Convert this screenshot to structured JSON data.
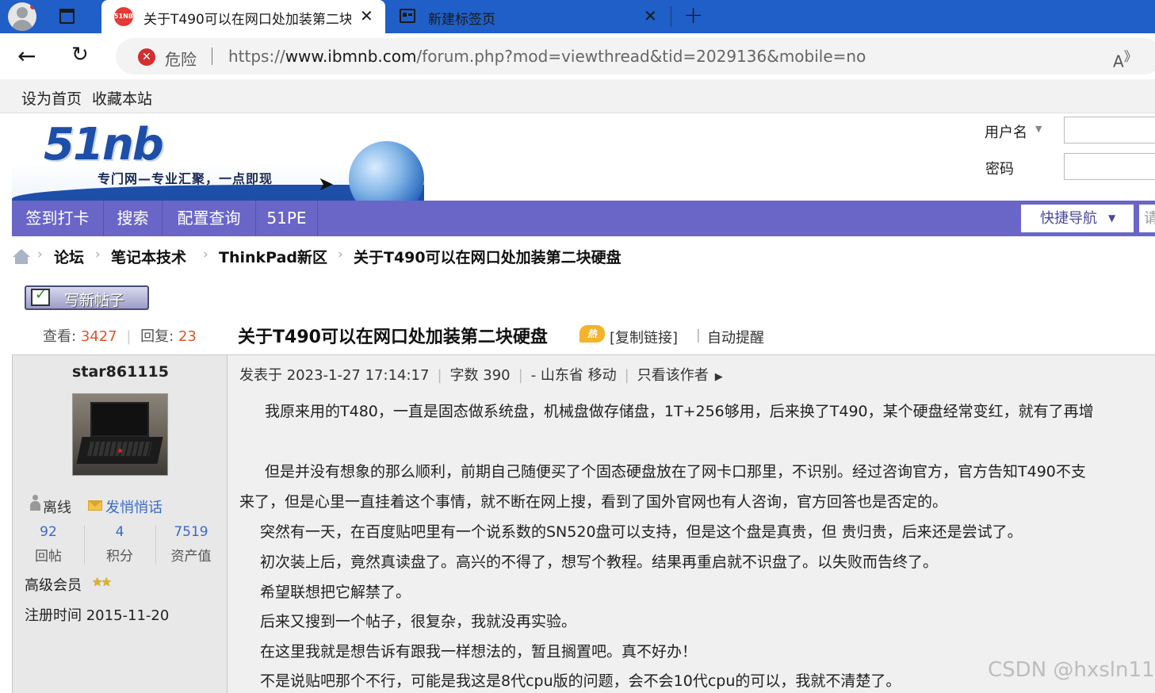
{
  "browser": {
    "tabs": [
      {
        "favicon": "51nb-logo",
        "title": "关于T490可以在网口处加装第二块硬盘",
        "active": true
      },
      {
        "favicon": "new-tab-icon",
        "title": "新建标签页",
        "active": false
      }
    ],
    "security_label": "危险",
    "url_prefix": "https://",
    "url_host": "www.ibmnb.com",
    "url_path": "/forum.php?mod=viewthread&tid=2029136&mobile=no"
  },
  "topbar": {
    "set_home": "设为首页",
    "bookmark": "收藏本站"
  },
  "logo": {
    "text": "51nb",
    "slogan": "专门网—专业汇聚，一点即现"
  },
  "login": {
    "username_label": "用户名",
    "password_label": "密码"
  },
  "nav": {
    "items": [
      "签到打卡",
      "搜索",
      "配置查询",
      "51PE"
    ],
    "quick_nav": "快捷导航",
    "search_placeholder": "请"
  },
  "breadcrumb": [
    "论坛",
    "笔记本技术",
    "ThinkPad新区",
    "关于T490可以在网口处加装第二块硬盘"
  ],
  "new_post": "写新帖子",
  "thread": {
    "views_label": "查看:",
    "views": "3427",
    "replies_label": "回复:",
    "replies": "23",
    "title": "关于T490可以在网口处加装第二块硬盘",
    "hot_badge": "热",
    "copy_link": "[复制链接]",
    "auto_remind": "自动提醒"
  },
  "author": {
    "name": "star861115",
    "status": "离线",
    "pm": "发悄悄话",
    "stats": [
      {
        "value": "92",
        "label": "回帖"
      },
      {
        "value": "4",
        "label": "积分"
      },
      {
        "value": "7519",
        "label": "资产值"
      }
    ],
    "level": "高级会员",
    "stars": "★★",
    "reg_date": "注册时间  2015-11-20"
  },
  "post": {
    "posted_at": "发表于 2023-1-27 17:14:17",
    "word_count": "字数 390",
    "location": "- 山东省 移动",
    "only_author": "只看该作者",
    "lines": [
      "我原来用的T480，一直是固态做系统盘，机械盘做存储盘，1T+256够用，后来换了T490，某个硬盘经常变红，就有了再增",
      "但是并没有想象的那么顺利，前期自己随便买了个固态硬盘放在了网卡口那里，不识别。经过咨询官方，官方告知T490不支",
      "来了，但是心里一直挂着这个事情，就不断在网上搜，看到了国外官网也有人咨询，官方回答也是否定的。",
      "突然有一天，在百度贴吧里有一个说系数的SN520盘可以支持，但是这个盘是真贵，但 贵归贵，后来还是尝试了。",
      "初次装上后，竟然真读盘了。高兴的不得了，想写个教程。结果再重启就不识盘了。以失败而告终了。",
      "希望联想把它解禁了。",
      "后来又搜到一个帖子，很复杂，我就没再实验。",
      "在这里我就是想告诉有跟我一样想法的，暂且搁置吧。真不好办！",
      "不是说贴吧那个不行，可能是我这是8代cpu版的问题，会不会10代cpu的可以，我就不清楚了。"
    ]
  },
  "watermark": "CSDN @hxsln11"
}
